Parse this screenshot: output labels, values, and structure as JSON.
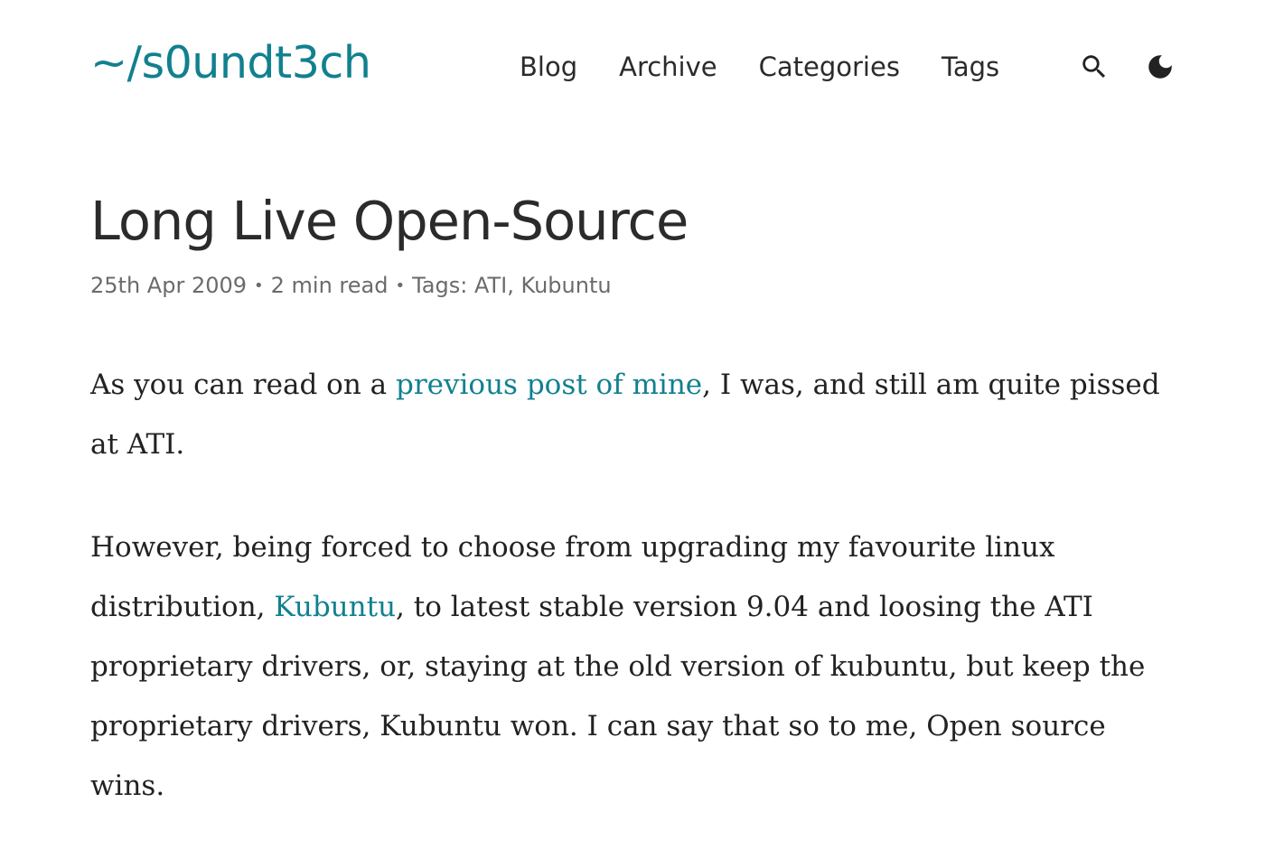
{
  "site": {
    "logo": "~/s0undt3ch"
  },
  "nav": {
    "items": [
      "Blog",
      "Archive",
      "Categories",
      "Tags"
    ],
    "search_icon": "search-icon",
    "theme_icon": "moon-icon"
  },
  "post": {
    "title": "Long Live Open-Source",
    "date": "25th Apr 2009",
    "separator": "•",
    "read_time": "2 min read",
    "tags_label": "Tags:",
    "tags": [
      "ATI",
      "Kubuntu"
    ],
    "tag_separator": ","
  },
  "body": {
    "p1": {
      "before": "As you can read on a ",
      "link": "previous post of mine",
      "after": ", I was, and still am quite pissed at ATI."
    },
    "p2": {
      "before": "However, being forced to choose from upgrading my favourite linux distribution, ",
      "link": "Kubuntu",
      "after": ", to latest stable version 9.04 and loosing the ATI proprietary drivers, or, staying at the old version of kubuntu, but keep the proprietary drivers, Kubuntu won. I can say that so to me, Open source wins."
    }
  },
  "colors": {
    "accent": "#11808f",
    "text": "#222222",
    "meta": "#6b6b6b"
  }
}
